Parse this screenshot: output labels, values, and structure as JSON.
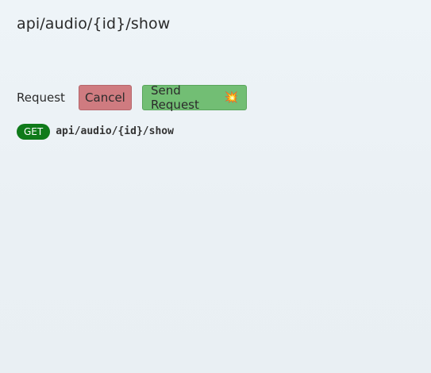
{
  "header": {
    "title": "api/audio/{id}/show"
  },
  "request": {
    "label": "Request",
    "cancel_label": "Cancel",
    "send_label": "Send Request",
    "send_emoji": "💥"
  },
  "endpoint": {
    "method": "GET",
    "path": "api/audio/{id}/show"
  },
  "colors": {
    "cancel": "#cf7b80",
    "send": "#72be74",
    "method_get": "#0f7a1a"
  },
  "icons": {
    "send_icon": "collision-icon"
  }
}
